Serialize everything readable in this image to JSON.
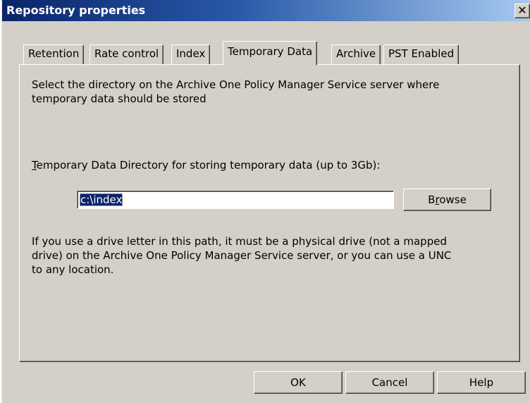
{
  "window": {
    "title": "Repository properties",
    "close_glyph": "✕"
  },
  "tabs": [
    {
      "label": "Retention",
      "active": false
    },
    {
      "label": "Rate control",
      "active": false
    },
    {
      "label": "Index",
      "active": false
    },
    {
      "label": "Temporary Data",
      "active": true
    },
    {
      "label": "Archive",
      "active": false
    },
    {
      "label": "PST Enabled",
      "active": false
    }
  ],
  "panel": {
    "intro_line1": "Select the directory on the Archive One Policy Manager Service server where",
    "intro_line2": "temporary data should be stored",
    "dir_label_mnemonic": "T",
    "dir_label_rest": "emporary Data Directory for storing temporary data (up to 3Gb):",
    "dir_value": "c:\\index",
    "browse_pre": "B",
    "browse_mnemonic": "r",
    "browse_post": "owse",
    "note_line1": "If you use a drive letter in this path, it must be a physical drive (not a mapped",
    "note_line2": "drive) on the Archive One Policy Manager Service server, or you can use a UNC",
    "note_line3": "to any location."
  },
  "buttons": {
    "ok": "OK",
    "cancel": "Cancel",
    "help": "Help"
  },
  "colors": {
    "titlebar_start": "#0a246a",
    "titlebar_end": "#a6caf0",
    "face": "#d4d0c8",
    "selection": "#0a246a"
  }
}
